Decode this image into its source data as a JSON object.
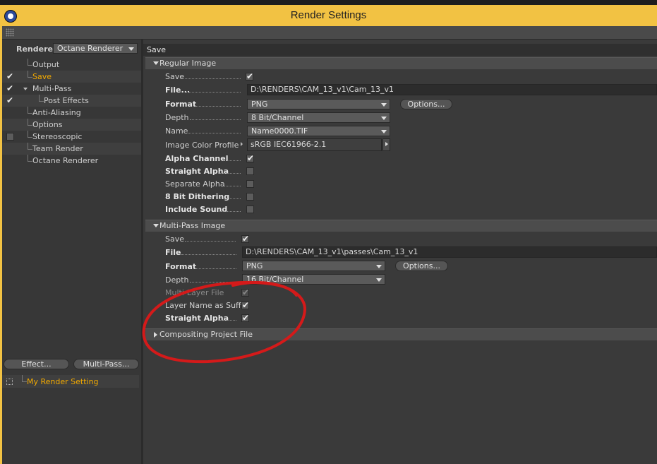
{
  "window": {
    "title": "Render Settings"
  },
  "left": {
    "renderer_label": "Renderer",
    "renderer_value": "Octane Renderer",
    "tree": [
      {
        "label": "Output",
        "checked": null
      },
      {
        "label": "Save",
        "checked": true,
        "selected": true
      },
      {
        "label": "Multi-Pass",
        "checked": true
      },
      {
        "label": "Post Effects",
        "checked": true
      },
      {
        "label": "Anti-Aliasing",
        "checked": null
      },
      {
        "label": "Options",
        "checked": null
      },
      {
        "label": "Stereoscopic",
        "checked": false
      },
      {
        "label": "Team Render",
        "checked": null
      },
      {
        "label": "Octane Renderer",
        "checked": null
      }
    ],
    "effect_button": "Effect...",
    "multipass_button": "Multi-Pass...",
    "render_setting": "My Render Setting"
  },
  "right": {
    "section_title": "Save",
    "regular": {
      "header": "Regular Image",
      "save_label": "Save",
      "save_checked": true,
      "file_label": "File...",
      "file_value": "D:\\RENDERS\\CAM_13_v1\\Cam_13_v1",
      "format_label": "Format",
      "format_value": "PNG",
      "options_button": "Options...",
      "depth_label": "Depth",
      "depth_value": "8 Bit/Channel",
      "name_label": "Name",
      "name_value": "Name0000.TIF",
      "profile_label": "Image Color Profile",
      "profile_value": "sRGB IEC61966-2.1",
      "alpha_label": "Alpha Channel",
      "alpha_checked": true,
      "straight_label": "Straight Alpha",
      "straight_checked": false,
      "separate_label": "Separate Alpha",
      "separate_checked": false,
      "dither_label": "8 Bit Dithering",
      "dither_checked": false,
      "sound_label": "Include Sound",
      "sound_checked": false
    },
    "multipass": {
      "header": "Multi-Pass Image",
      "save_label": "Save",
      "save_checked": true,
      "file_label": "File",
      "file_value": "D:\\RENDERS\\CAM_13_v1\\passes\\Cam_13_v1",
      "format_label": "Format",
      "format_value": "PNG",
      "options_button": "Options...",
      "depth_label": "Depth",
      "depth_value": "16 Bit/Channel",
      "multilayer_label": "Multi-Layer File",
      "multilayer_checked": true,
      "suffix_label": "Layer Name as Suffix",
      "suffix_checked": true,
      "straight_label": "Straight Alpha",
      "straight_checked": true
    },
    "compositing": {
      "header": "Compositing Project File"
    }
  },
  "annotation": {
    "color": "#d41a1a"
  },
  "colors": {
    "accent": "#f2c243",
    "selected_text": "#f2a900"
  }
}
